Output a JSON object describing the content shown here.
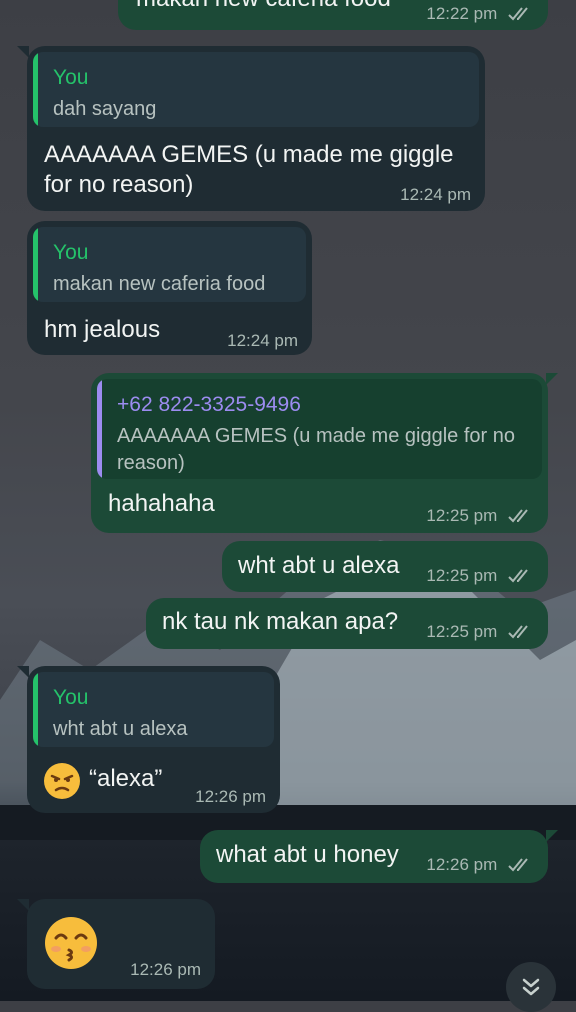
{
  "messages": [
    {
      "id": "m0",
      "direction": "out",
      "text": "makan new caferia food",
      "time": "12:22 pm",
      "read": true
    },
    {
      "id": "m1",
      "direction": "in",
      "reply_to": {
        "author": "You",
        "text": "dah sayang"
      },
      "text": "AAAAAAA GEMES (u made me giggle for no reason)",
      "time": "12:24 pm"
    },
    {
      "id": "m2",
      "direction": "in",
      "reply_to": {
        "author": "You",
        "text": "makan new caferia food"
      },
      "text": "hm jealous",
      "time": "12:24 pm"
    },
    {
      "id": "m3",
      "direction": "out",
      "reply_to": {
        "author": "+62 822-3325-9496",
        "text": "AAAAAAA GEMES (u made me giggle for no reason)"
      },
      "text": "hahahaha",
      "time": "12:25 pm",
      "read": true
    },
    {
      "id": "m4",
      "direction": "out",
      "text": "wht abt u alexa",
      "time": "12:25 pm",
      "read": true
    },
    {
      "id": "m5",
      "direction": "out",
      "text": "nk tau nk makan apa?",
      "time": "12:25 pm",
      "read": true
    },
    {
      "id": "m6",
      "direction": "in",
      "reply_to": {
        "author": "You",
        "text": "wht abt u alexa"
      },
      "emoji": "unamused-face-emoji",
      "text": "“alexa”",
      "time": "12:26 pm"
    },
    {
      "id": "m7",
      "direction": "out",
      "text": "what abt u honey",
      "time": "12:26 pm",
      "read": true
    },
    {
      "id": "m8",
      "direction": "in",
      "emoji": "kissing-face-smiling-eyes-emoji",
      "time": "12:26 pm"
    }
  ],
  "colors": {
    "incoming_bubble": "#1f2c33",
    "outgoing_bubble": "#1c4a37",
    "you_accent": "#25c26a",
    "contact_accent": "#9c8cf0",
    "read_ticks": "#aab9b4"
  },
  "icons": {
    "read_receipt": "double-check-icon",
    "scroll_down": "double-chevron-down-icon"
  }
}
